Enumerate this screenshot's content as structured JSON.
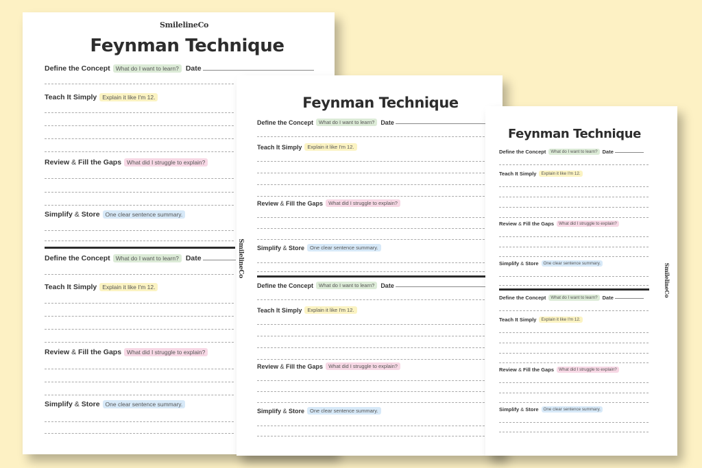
{
  "brand": "SmilelineCo",
  "title": "Feynman Technique",
  "sections": {
    "define": {
      "label": "Define the Concept",
      "prompt": "What do I want to learn?"
    },
    "teach": {
      "label": "Teach It Simply",
      "prompt": "Explain it like I'm 12."
    },
    "review": {
      "label_a": "Review",
      "label_amp": " & ",
      "label_b": "Fill the Gaps",
      "prompt": "What did I struggle to explain?"
    },
    "simplify": {
      "label_a": "Simplify",
      "label_amp": " & ",
      "label_b": "Store",
      "prompt": "One clear sentence summary."
    }
  },
  "date_label": "Date",
  "colors": {
    "background": "#fdf1c4",
    "define_tag": "#dcebd7",
    "teach_tag": "#fbf3c2",
    "review_tag": "#f7d8e5",
    "simplify_tag": "#d7e9f8"
  }
}
